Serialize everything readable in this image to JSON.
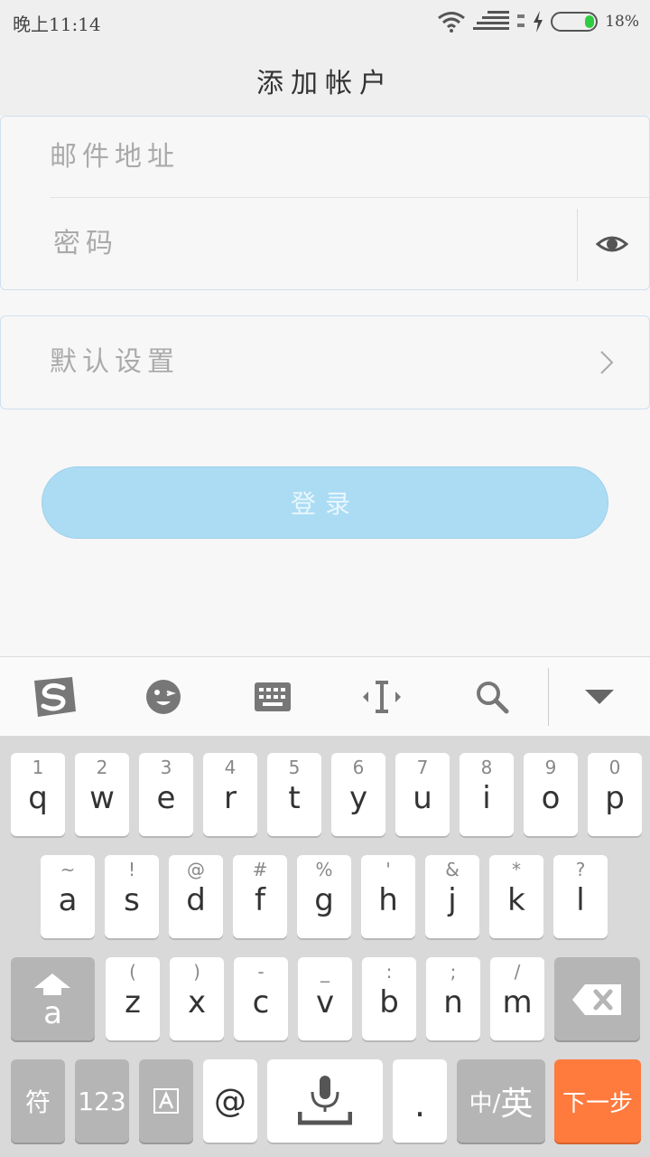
{
  "status_bar": {
    "time": "晚上11:14",
    "battery_percent": "18%",
    "battery_level": 0.18
  },
  "header": {
    "title": "添加帐户"
  },
  "form": {
    "email_placeholder": "邮件地址",
    "password_placeholder": "密码",
    "settings_label": "默认设置",
    "login_button": "登录"
  },
  "keyboard": {
    "toolbar": [
      "sogou-logo-icon",
      "emoji-icon",
      "keyboard-icon",
      "cursor-move-icon",
      "search-icon",
      "collapse-keyboard-icon"
    ],
    "row1": [
      {
        "sub": "1",
        "key": "q"
      },
      {
        "sub": "2",
        "key": "w"
      },
      {
        "sub": "3",
        "key": "e"
      },
      {
        "sub": "4",
        "key": "r"
      },
      {
        "sub": "5",
        "key": "t"
      },
      {
        "sub": "6",
        "key": "y"
      },
      {
        "sub": "7",
        "key": "u"
      },
      {
        "sub": "8",
        "key": "i"
      },
      {
        "sub": "9",
        "key": "o"
      },
      {
        "sub": "0",
        "key": "p"
      }
    ],
    "row2": [
      {
        "sub": "~",
        "key": "a"
      },
      {
        "sub": "!",
        "key": "s"
      },
      {
        "sub": "@",
        "key": "d"
      },
      {
        "sub": "#",
        "key": "f"
      },
      {
        "sub": "%",
        "key": "g"
      },
      {
        "sub": "'",
        "key": "h"
      },
      {
        "sub": "&",
        "key": "j"
      },
      {
        "sub": "*",
        "key": "k"
      },
      {
        "sub": "?",
        "key": "l"
      }
    ],
    "row3": [
      {
        "sub": "(",
        "key": "z"
      },
      {
        "sub": ")",
        "key": "x"
      },
      {
        "sub": "-",
        "key": "c"
      },
      {
        "sub": "_",
        "key": "v"
      },
      {
        "sub": ":",
        "key": "b"
      },
      {
        "sub": ";",
        "key": "n"
      },
      {
        "sub": "/",
        "key": "m"
      }
    ],
    "shift_label": "a",
    "symbols_key": "符",
    "numbers_key": "123",
    "at_key": "@",
    "period_key": ".",
    "lang_key_zh": "中/",
    "lang_key_en": "英",
    "next_key": "下一步"
  },
  "colors": {
    "accent_login": "#abdcf4",
    "next_key": "#ff7a3d",
    "battery": "#2ecc40"
  }
}
